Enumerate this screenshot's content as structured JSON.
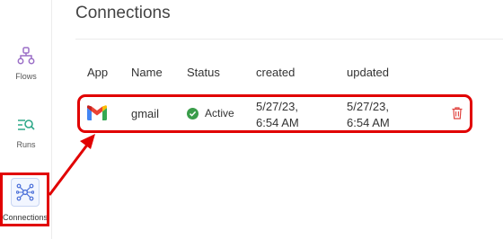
{
  "sidebar": {
    "items": [
      {
        "label": "Flows",
        "icon": "flow-icon"
      },
      {
        "label": "Runs",
        "icon": "runs-icon"
      },
      {
        "label": "Connections",
        "icon": "connections-icon"
      }
    ]
  },
  "page": {
    "title": "Connections"
  },
  "table": {
    "headers": [
      "App",
      "Name",
      "Status",
      "created",
      "updated"
    ],
    "rows": [
      {
        "app_icon": "gmail-icon",
        "name": "gmail",
        "status": "Active",
        "created_date": "5/27/23,",
        "created_time": "6:54 AM",
        "updated_date": "5/27/23,",
        "updated_time": "6:54 AM",
        "action_icon": "trash-icon"
      }
    ]
  },
  "colors": {
    "highlight": "#e10000",
    "accent": "#4a6fd9",
    "flow_icon": "#9b6fc7",
    "runs_icon": "#2fa889",
    "active": "#3a9d4a",
    "delete": "#e0433f"
  }
}
